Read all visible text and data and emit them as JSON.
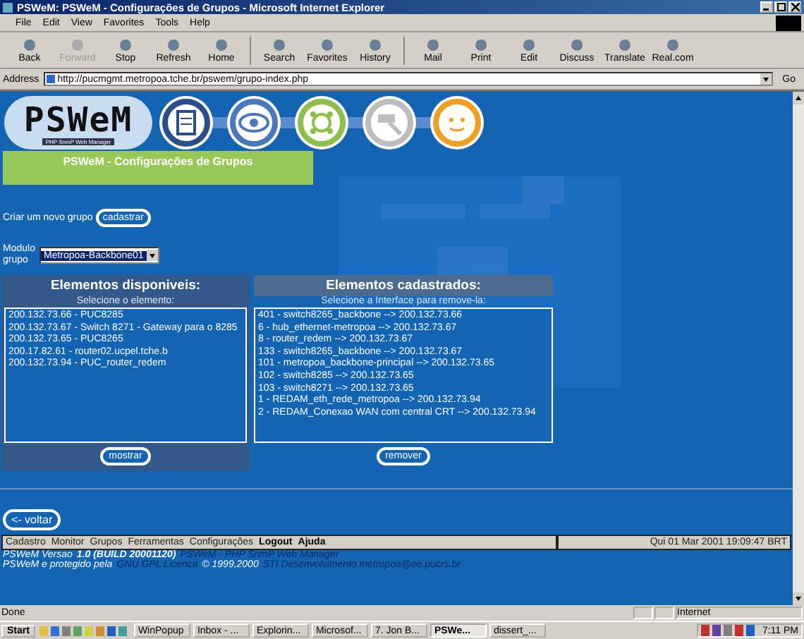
{
  "window": {
    "title": "PSWeM: PSWeM - Configurações de Grupos - Microsoft Internet Explorer"
  },
  "menu": [
    "File",
    "Edit",
    "View",
    "Favorites",
    "Tools",
    "Help"
  ],
  "toolbar": [
    {
      "label": "Back",
      "disabled": false
    },
    {
      "label": "Forward",
      "disabled": true
    },
    {
      "label": "Stop",
      "disabled": false
    },
    {
      "label": "Refresh",
      "disabled": false
    },
    {
      "label": "Home",
      "disabled": false
    },
    {
      "label": "Search",
      "disabled": false
    },
    {
      "label": "Favorites",
      "disabled": false
    },
    {
      "label": "History",
      "disabled": false
    },
    {
      "label": "Mail",
      "disabled": false
    },
    {
      "label": "Print",
      "disabled": false
    },
    {
      "label": "Edit",
      "disabled": false
    },
    {
      "label": "Discuss",
      "disabled": false
    },
    {
      "label": "Translate",
      "disabled": false
    },
    {
      "label": "Real.com",
      "disabled": false
    }
  ],
  "address": {
    "label": "Address",
    "url": "http://pucmgmt.metropoa.tche.br/pswem/grupo-index.php",
    "go": "Go"
  },
  "logo": {
    "name": "PSWeM",
    "tagline": "PHP SnmP Web Manager"
  },
  "header": "PSWeM - Configurações de Grupos",
  "create_group": {
    "text": "Criar um novo grupo",
    "button": "cadastrar"
  },
  "module": {
    "label": "Modulo grupo",
    "value": "Metropoa-Backbone01"
  },
  "available": {
    "title": "Elementos disponiveis:",
    "hint": "Selecione o elemento:",
    "items": [
      "200.132.73.66 - PUC8285",
      "200.132.73.67 - Switch 8271 - Gateway para o 8285",
      "200.132.73.65 - PUC8265",
      "200.17.82.61 - router02.ucpel.tche.b",
      "200.132.73.94 - PUC_router_redem"
    ],
    "button": "mostrar"
  },
  "registered": {
    "title": "Elementos cadastrados:",
    "hint": "Selecione a Interface para remove-la:",
    "items": [
      "401 - switch8265_backbone --> 200.132.73.66",
      "6 - hub_ethernet-metropoa --> 200.132.73.67",
      "8 - router_redem --> 200.132.73.67",
      "133 - switch8265_backbone --> 200.132.73.67",
      "101 - metropoa_backbone-principal --> 200.132.73.65",
      "102 - switch8285 --> 200.132.73.65",
      "103 - switch8271 --> 200.132.73.65",
      "1 - REDAM_eth_rede_metropoa --> 200.132.73.94",
      "2 - REDAM_Conexao WAN com central CRT --> 200.132.73.94"
    ],
    "button": "remover"
  },
  "back_button": "<- voltar",
  "nav": [
    {
      "label": "Cadastro",
      "bold": false
    },
    {
      "label": "Monitor",
      "bold": false
    },
    {
      "label": "Grupos",
      "bold": false
    },
    {
      "label": "Ferramentas",
      "bold": false
    },
    {
      "label": "Configurações",
      "bold": false
    },
    {
      "label": "Logout",
      "bold": true
    },
    {
      "label": "Ajuda",
      "bold": true
    }
  ],
  "date": "Qui 01 Mar 2001 19:09:47 BRT",
  "footer": [
    [
      {
        "text": "PSWeM Versao",
        "kind": "light"
      },
      {
        "text": "1.0 (BUILD 20001120)",
        "kind": "strong"
      },
      {
        "text": "PSWeM - PHP SnmP Web Manager",
        "kind": "dark"
      }
    ],
    [
      {
        "text": "PSWeM e protegido pela",
        "kind": "light"
      },
      {
        "text": "GNU GPL Licença",
        "kind": "dark"
      },
      {
        "text": "© 1999,2000",
        "kind": "light"
      },
      {
        "text": "STI Desenvolvimento metropoa@ee.pucrs.br",
        "kind": "dark"
      }
    ]
  ],
  "status": {
    "text": "Done",
    "zone": "Internet"
  },
  "taskbar": {
    "start": "Start",
    "tasks": [
      {
        "label": "WinPopup",
        "selected": false
      },
      {
        "label": "Inbox - ...",
        "selected": false
      },
      {
        "label": "Explorin...",
        "selected": false
      },
      {
        "label": "Microsof...",
        "selected": false
      },
      {
        "label": "7. Jon B...",
        "selected": false
      },
      {
        "label": "PSWe...",
        "selected": true
      },
      {
        "label": "dissert_...",
        "selected": false
      }
    ],
    "clock": "7:11 PM"
  }
}
